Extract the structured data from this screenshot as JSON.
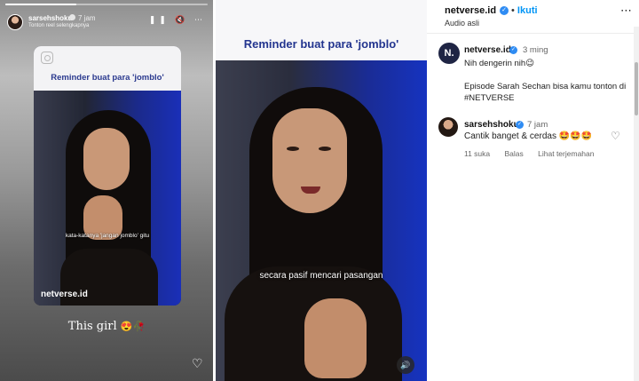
{
  "story": {
    "username": "sarsehshoku",
    "time": "7 jam",
    "subtitle": "Tonton reel selengkapnya",
    "progress_fraction": 0.35,
    "controls": "❚❚ 🔇 ⋯",
    "card": {
      "title": "Reminder buat para 'jomblo'",
      "caption": "kata-katanya 'jangan jomblo' gitu",
      "brand": "netverse.id"
    },
    "reply_text": "This girl",
    "reply_emoji": "😍🥀",
    "like_icon": "heart-outline-icon"
  },
  "video": {
    "title": "Reminder buat para 'jomblo'",
    "caption": "secara pasif mencari pasangan",
    "sound_icon": "speaker-icon"
  },
  "post": {
    "username": "netverse.id",
    "follow_sep": "•",
    "follow_label": "Ikuti",
    "audio": "Audio asli",
    "more": "⋯",
    "comments": [
      {
        "avatar_text": "N.",
        "username": "netverse.id",
        "time": "3 ming",
        "line1": "Nih dengerin nih😉",
        "line2": "Episode Sarah Sechan bisa kamu tonton di #NETVERSE"
      },
      {
        "username": "sarsehshoku",
        "time": "7 jam",
        "text": "Cantik banget & cerdas",
        "emoji": "🤩🤩🤩",
        "likes": "11 suka",
        "reply": "Balas",
        "translate": "Lihat terjemahan"
      }
    ]
  },
  "colors": {
    "title_blue": "#23358f",
    "verified_blue": "#2f8cf3",
    "follow_blue": "#0095f6"
  }
}
